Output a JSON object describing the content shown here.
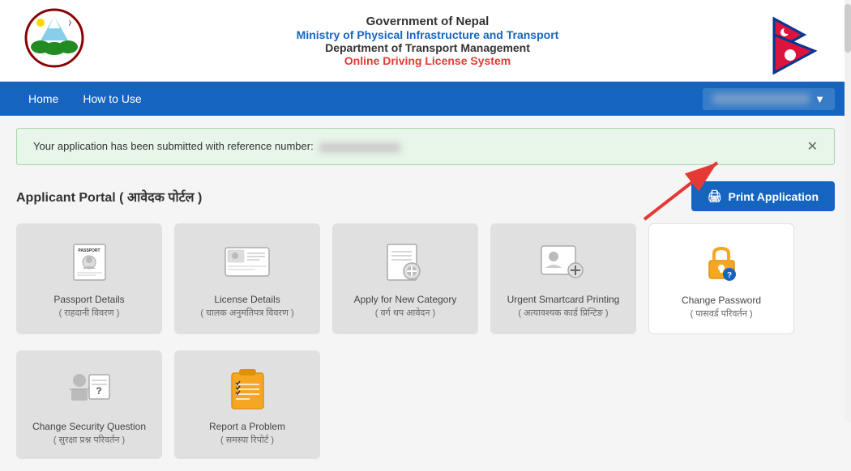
{
  "header": {
    "gov_title": "Government of Nepal",
    "ministry": "Ministry of Physical Infrastructure and Transport",
    "dept": "Department of Transport Management",
    "system": "Online Driving License System"
  },
  "navbar": {
    "items": [
      {
        "label": "Home",
        "id": "home"
      },
      {
        "label": "How to Use",
        "id": "how-to-use"
      }
    ],
    "user_label": "User"
  },
  "alert": {
    "message": "Your application has been submitted with reference number:",
    "ref_number": "XXXXXXXXXX"
  },
  "portal": {
    "title": "Applicant Portal ( आवेदक पोर्टल )",
    "print_btn_label": "Print Application"
  },
  "cards": [
    {
      "id": "passport-details",
      "label": "Passport Details",
      "nepali": "( राहदानी विवरण )"
    },
    {
      "id": "license-details",
      "label": "License Details",
      "nepali": "( चालक अनुमतिपत्र विवरण )"
    },
    {
      "id": "new-category",
      "label": "Apply for New Category",
      "nepali": "( वर्ग थप आवेदन )"
    },
    {
      "id": "urgent-smartcard",
      "label": "Urgent Smartcard Printing",
      "nepali": "( अत्यावश्यक कार्ड प्रिन्टिङ )"
    },
    {
      "id": "change-password",
      "label": "Change Password",
      "nepali": "( पासवर्ड परिवर्तन )"
    }
  ],
  "cards_row2": [
    {
      "id": "change-security",
      "label": "Change Security Question",
      "nepali": "( सुरक्षा प्रश्न परिवर्तन )"
    },
    {
      "id": "report-problem",
      "label": "Report a Problem",
      "nepali": "( समस्या रिपोर्ट )"
    }
  ],
  "colors": {
    "blue": "#1565C0",
    "red": "#e53935",
    "light_green_bg": "#e8f5e9",
    "card_bg": "#e0e0e0"
  },
  "icons": {
    "print": "🖨",
    "passport": "📄",
    "license": "🪪",
    "category": "📋",
    "smartcard": "👤",
    "password": "🔒",
    "security": "❓",
    "problem": "📋"
  }
}
